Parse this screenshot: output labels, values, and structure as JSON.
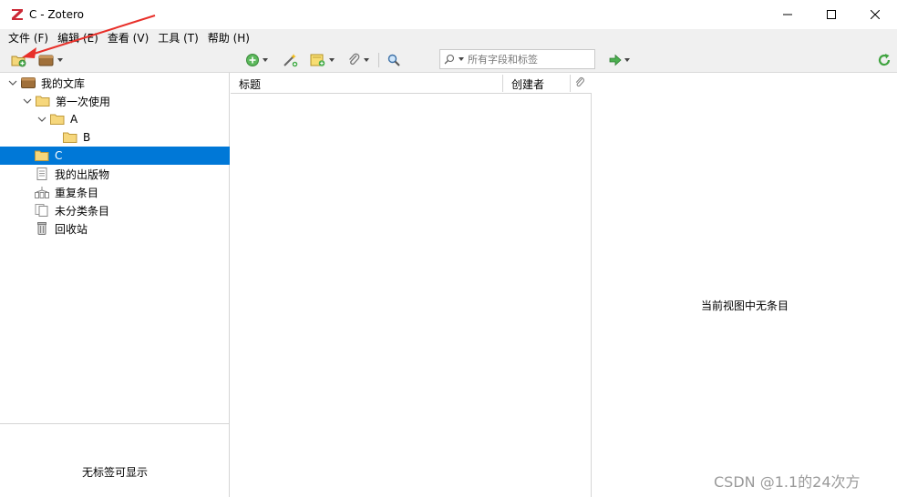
{
  "window": {
    "title": "C - Zotero"
  },
  "menubar": {
    "items": [
      "文件 (F)",
      "编辑 (E)",
      "查看 (V)",
      "工具 (T)",
      "帮助 (H)"
    ]
  },
  "toolbar": {
    "search_placeholder": "所有字段和标签"
  },
  "collections": {
    "items": [
      {
        "label": "我的文库",
        "icon": "library-icon",
        "expanded": true
      },
      {
        "label": "第一次使用",
        "icon": "folder-icon",
        "expanded": true
      },
      {
        "label": "A",
        "icon": "folder-icon",
        "expanded": true
      },
      {
        "label": "B",
        "icon": "folder-icon"
      },
      {
        "label": "C",
        "icon": "folder-icon",
        "selected": true
      },
      {
        "label": "我的出版物",
        "icon": "publications-icon"
      },
      {
        "label": "重复条目",
        "icon": "duplicate-items-icon"
      },
      {
        "label": "未分类条目",
        "icon": "unfiled-items-icon"
      },
      {
        "label": "回收站",
        "icon": "trash-icon"
      }
    ]
  },
  "tag_selector": {
    "empty_text": "无标签可显示"
  },
  "items_list": {
    "columns": [
      "标题",
      "创建者"
    ]
  },
  "item_pane": {
    "empty_text": "当前视图中无条目"
  },
  "watermark": "CSDN @1.1的24次方",
  "colors": {
    "selection": "#0078d7",
    "annotation_arrow": "#e8302a",
    "logo_red": "#cc2936"
  }
}
